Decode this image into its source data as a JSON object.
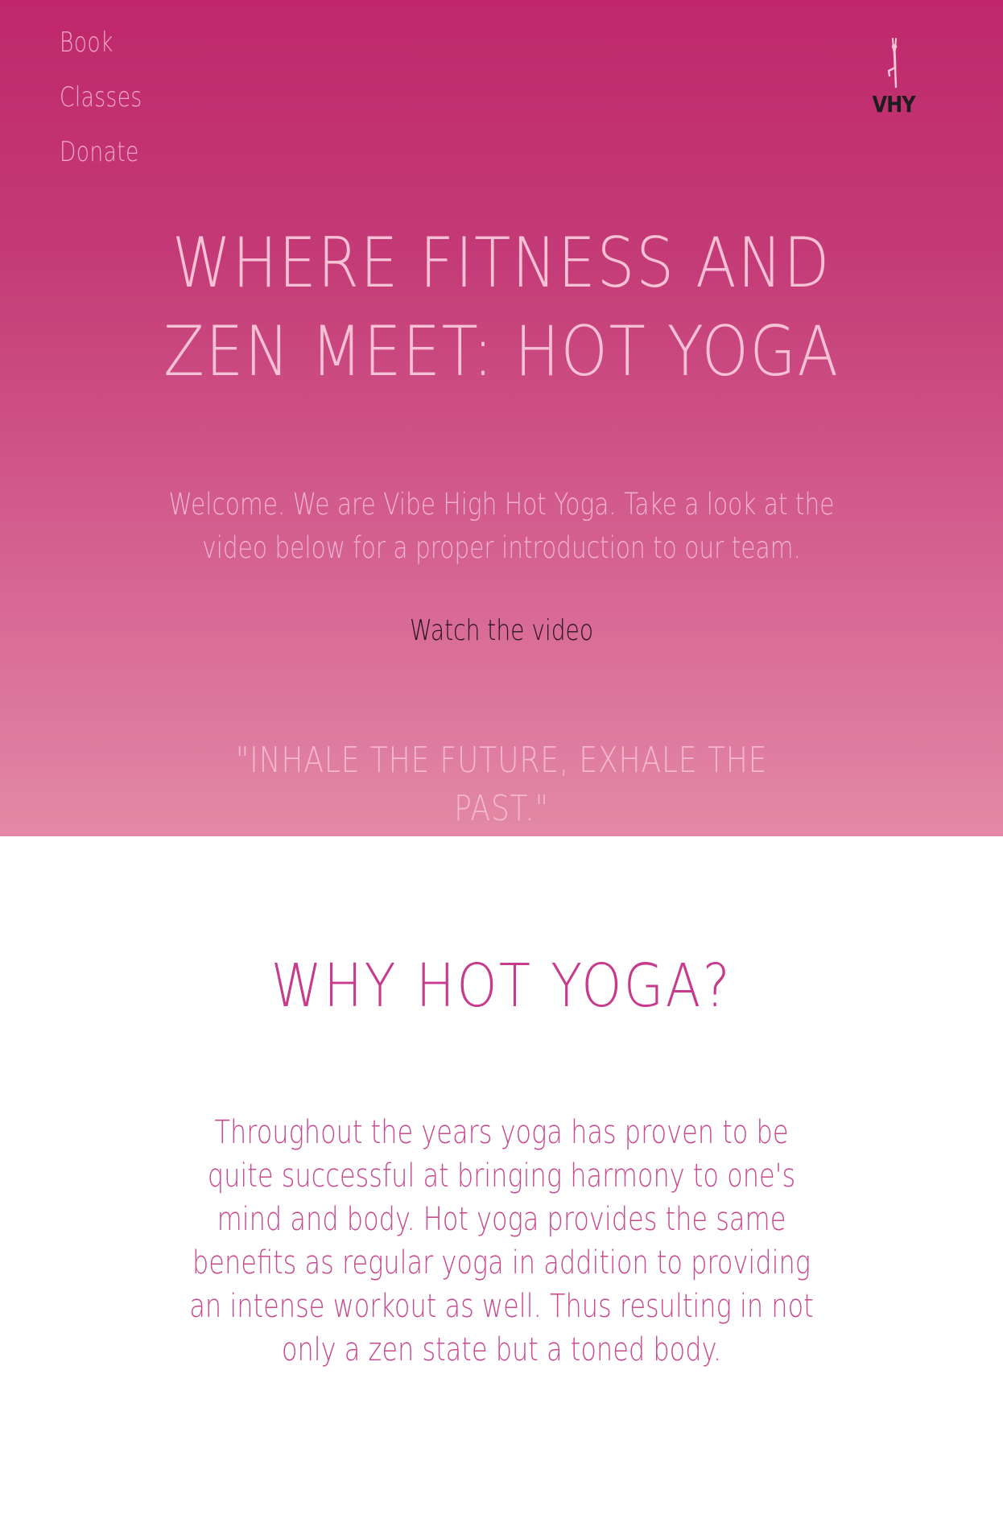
{
  "nav": {
    "items": [
      {
        "label": "Book"
      },
      {
        "label": "Classes"
      },
      {
        "label": "Donate"
      }
    ]
  },
  "logo": {
    "text": "VHY",
    "icon": "yoga-tree-pose-figure"
  },
  "hero": {
    "title": "Where Fitness and Zen Meet: Hot Yoga",
    "welcome": "Welcome. We are Vibe High Hot Yoga. Take a look at the video below for a proper introduction to our team.",
    "watch_label": "Watch the video",
    "quote": "\"INHALE THE FUTURE, EXHALE THE PAST.\""
  },
  "why": {
    "title": "WHY HOT YOGA?",
    "text": "Throughout the years yoga has proven to be quite successful at bringing harmony to one's mind and body. Hot yoga provides the same benefits as regular yoga in addition to providing an intense workout as well. Thus resulting in not only a zen state but a toned body."
  },
  "colors": {
    "hero_top": "#c0286b",
    "hero_bottom": "#e389a6",
    "nav_text": "#f0a9c6",
    "title_text": "#f6c0d5",
    "watch_text": "#2a1420",
    "why_title": "#c83a8c",
    "why_text": "#c94a8e",
    "background": "#ffffff"
  }
}
